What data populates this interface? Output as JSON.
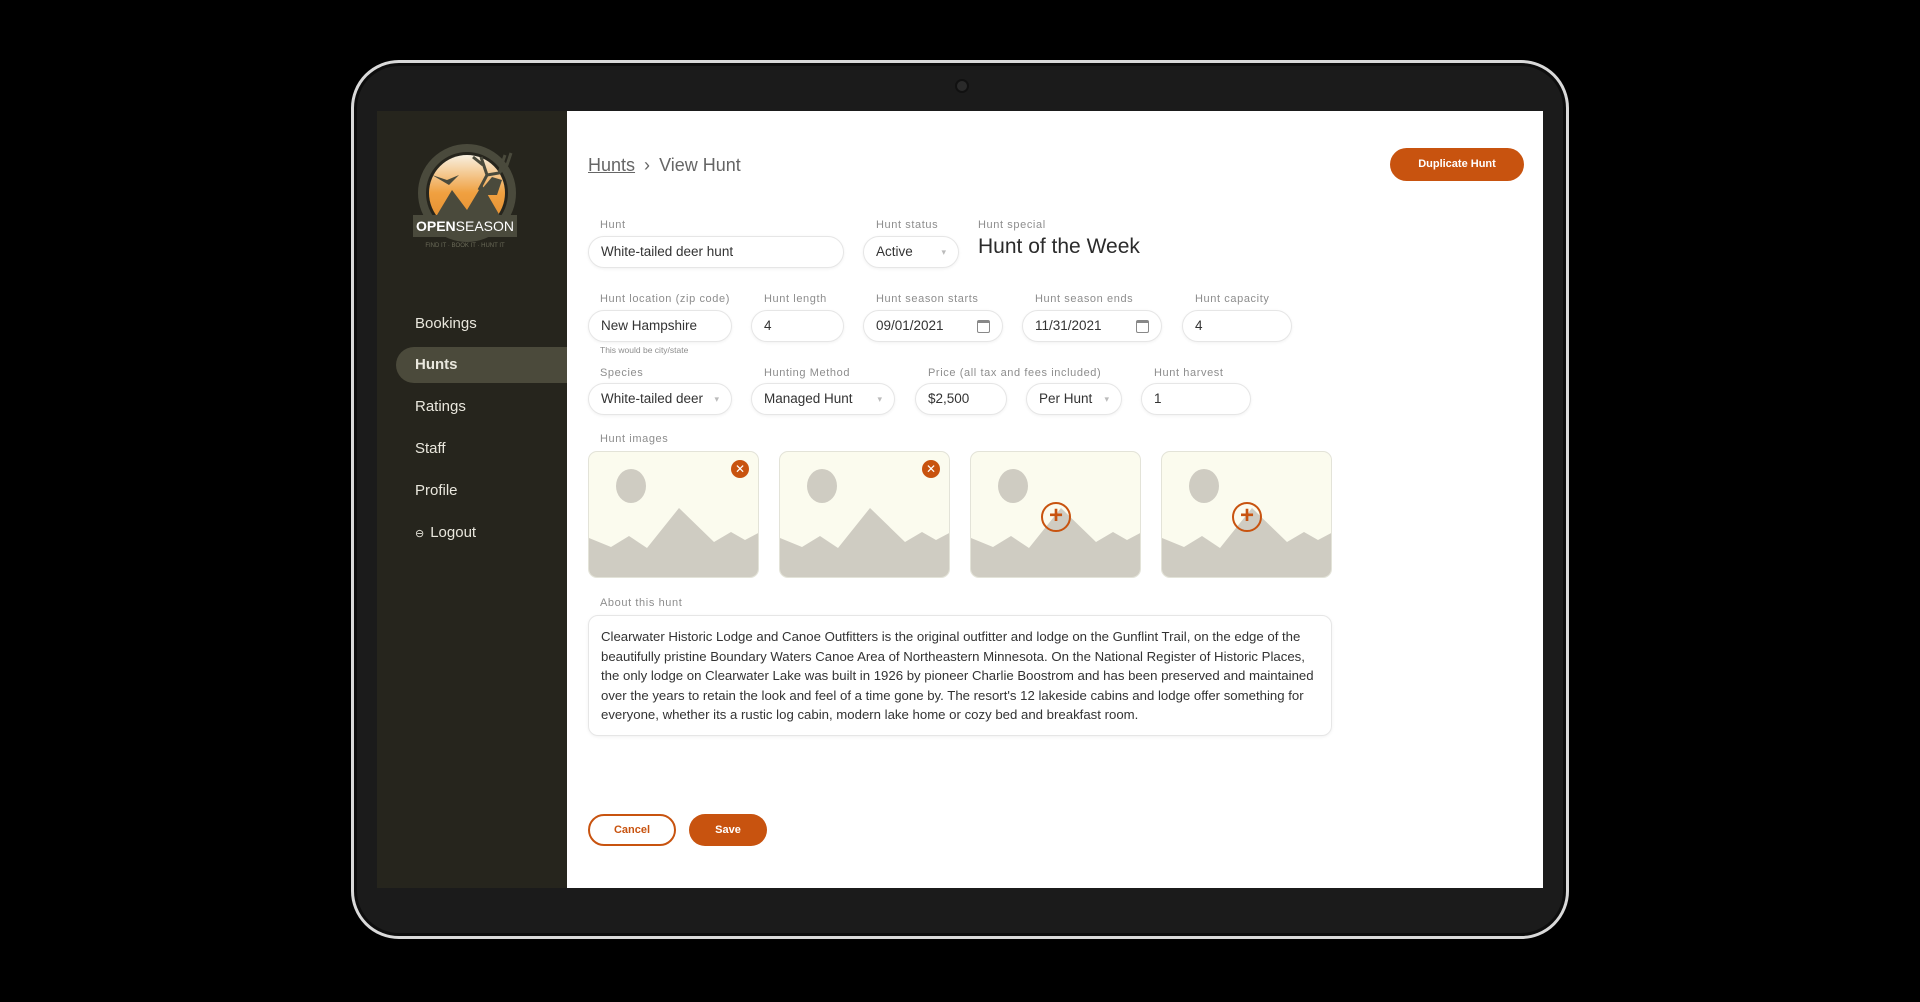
{
  "brand": {
    "name_bold": "OPEN",
    "name_light": "SEASON",
    "tagline": "FIND IT · BOOK IT · HUNT IT",
    "accent": "#c8530f",
    "sidebar_bg": "#26251d"
  },
  "sidebar": {
    "items": [
      {
        "label": "Bookings"
      },
      {
        "label": "Hunts",
        "active": true
      },
      {
        "label": "Ratings"
      },
      {
        "label": "Staff"
      },
      {
        "label": "Profile"
      },
      {
        "label": "Logout",
        "icon": "logout-icon"
      }
    ]
  },
  "breadcrumb": {
    "parent": "Hunts",
    "separator": "›",
    "current": "View Hunt"
  },
  "header": {
    "duplicate_label": "Duplicate Hunt"
  },
  "form": {
    "hunt": {
      "label": "Hunt",
      "value": "White-tailed deer hunt"
    },
    "status": {
      "label": "Hunt status",
      "value": "Active"
    },
    "special": {
      "label": "Hunt special",
      "value": "Hunt of the Week"
    },
    "location": {
      "label": "Hunt location (zip code)",
      "value": "New Hampshire",
      "hint": "This would be city/state"
    },
    "length": {
      "label": "Hunt length",
      "value": "4"
    },
    "start": {
      "label": "Hunt season starts",
      "value": "09/01/2021"
    },
    "end": {
      "label": "Hunt season ends",
      "value": "11/31/2021"
    },
    "capacity": {
      "label": "Hunt capacity",
      "value": "4"
    },
    "species": {
      "label": "Species",
      "value": "White-tailed deer"
    },
    "method": {
      "label": "Hunting Method",
      "value": "Managed Hunt"
    },
    "price": {
      "label": "Price (all tax and fees included)",
      "value": "$2,500"
    },
    "price_unit": {
      "value": "Per Hunt"
    },
    "harvest": {
      "label": "Hunt harvest",
      "value": "1"
    },
    "images": {
      "label": "Hunt images",
      "slots": [
        {
          "state": "filled"
        },
        {
          "state": "filled"
        },
        {
          "state": "empty"
        },
        {
          "state": "empty"
        }
      ]
    },
    "about": {
      "label": "About this hunt",
      "value": "Clearwater Historic Lodge and Canoe Outfitters is the original outfitter and lodge on the Gunflint Trail, on the edge of the beautifully pristine Boundary Waters Canoe Area of Northeastern Minnesota.  On the National Register of Historic Places, the only lodge on Clearwater Lake was built in 1926 by pioneer Charlie Boostrom and has been preserved and maintained over the years to retain the look and feel of a time gone by.  The resort's 12 lakeside cabins and lodge offer something for everyone, whether its a rustic log cabin, modern lake home or cozy bed and breakfast room."
    }
  },
  "actions": {
    "cancel": "Cancel",
    "save": "Save"
  }
}
